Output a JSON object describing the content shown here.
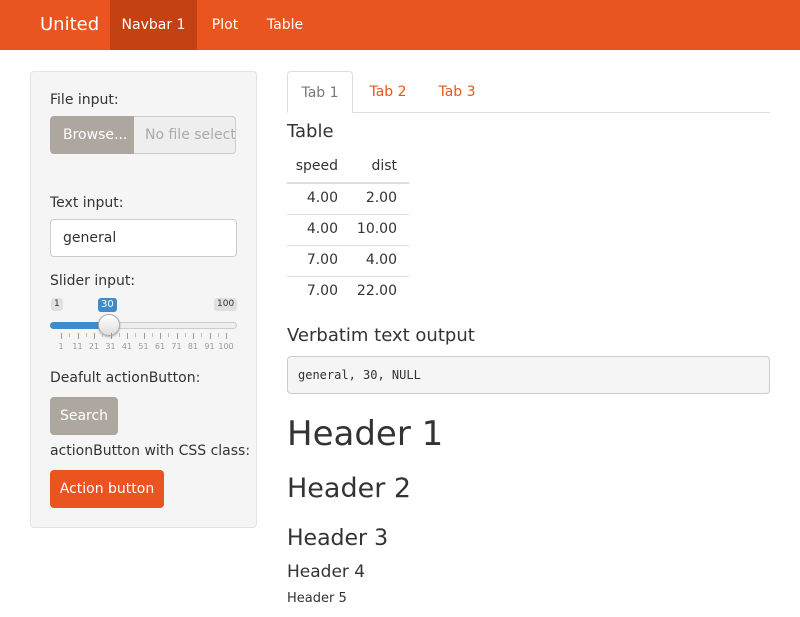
{
  "navbar": {
    "brand": "United",
    "items": [
      {
        "label": "Navbar 1",
        "active": true
      },
      {
        "label": "Plot",
        "active": false
      },
      {
        "label": "Table",
        "active": false
      }
    ],
    "color": "#e95420",
    "active_color": "#c34113"
  },
  "sidebar": {
    "file_input_label": "File input:",
    "browse_label": "Browse...",
    "file_placeholder": "No file selected",
    "text_input_label": "Text input:",
    "text_input_value": "general",
    "slider_label": "Slider input:",
    "slider": {
      "min": "1",
      "max": "100",
      "value": "30",
      "ticks": [
        "1",
        "11",
        "21",
        "31",
        "41",
        "51",
        "61",
        "71",
        "81",
        "91",
        "100"
      ]
    },
    "default_button_label": "Deafult actionButton:",
    "search_button": "Search",
    "css_button_label": "actionButton with CSS class:",
    "action_button": "Action button"
  },
  "tabs": [
    {
      "label": "Tab 1",
      "active": true
    },
    {
      "label": "Tab 2",
      "active": false
    },
    {
      "label": "Tab 3",
      "active": false
    }
  ],
  "table_section": {
    "title": "Table",
    "columns": [
      "speed",
      "dist"
    ],
    "rows": [
      [
        "4.00",
        "2.00"
      ],
      [
        "4.00",
        "10.00"
      ],
      [
        "7.00",
        "4.00"
      ],
      [
        "7.00",
        "22.00"
      ]
    ]
  },
  "verbatim_section": {
    "title": "Verbatim text output",
    "text": "general, 30, NULL"
  },
  "headers": {
    "h1": "Header 1",
    "h2": "Header 2",
    "h3": "Header 3",
    "h4": "Header 4",
    "h5": "Header 5"
  }
}
